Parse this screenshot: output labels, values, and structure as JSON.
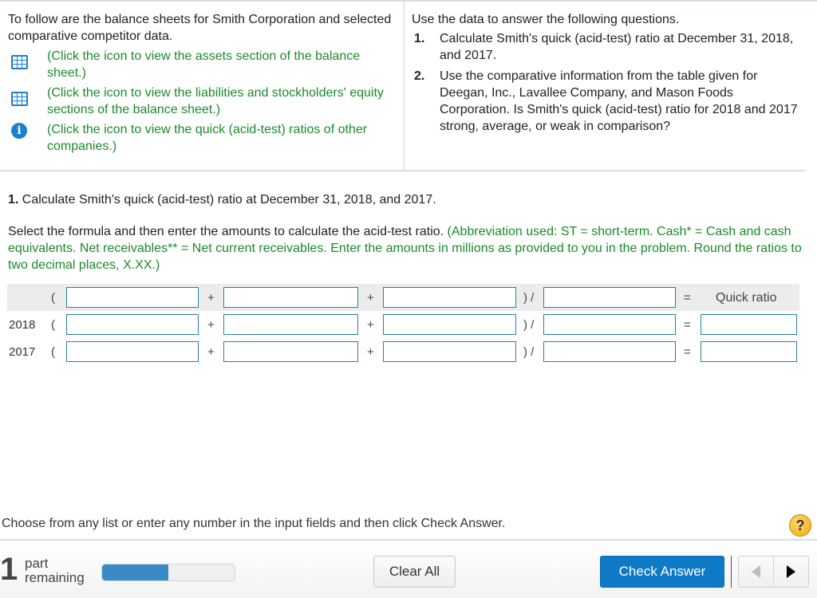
{
  "intro": {
    "text": "To follow are the balance sheets for Smith Corporation and selected comparative competitor data.",
    "links": [
      {
        "icon": "table-grid-icon",
        "text": "(Click the icon to view the assets section of the balance sheet.)"
      },
      {
        "icon": "table-grid-icon",
        "text": "(Click the icon to view the liabilities and stockholders' equity sections of the balance sheet.)"
      },
      {
        "icon": "info-icon",
        "icon_glyph": "i",
        "text": "(Click the icon to view the quick (acid-test) ratios of other companies.)"
      }
    ]
  },
  "questions": {
    "intro": "Use the data to answer the following questions.",
    "items": [
      {
        "num": "1.",
        "text": "Calculate Smith's quick (acid-test) ratio at December 31, 2018, and 2017."
      },
      {
        "num": "2.",
        "text": "Use the comparative information from the table given for Deegan, Inc., Lavallee Company, and Mason Foods Corporation. Is Smith's quick (acid-test) ratio for 2018 and 2017 strong, average, or weak in comparison?"
      }
    ]
  },
  "part1": {
    "heading_num": "1.",
    "heading_text": " Calculate Smith's quick (acid-test) ratio at December 31, 2018, and 2017.",
    "instruction_black": "Select the formula and then enter the amounts to calculate the acid-test ratio. ",
    "instruction_green": "(Abbreviation used: ST = short-term. Cash* = Cash and cash equivalents. Net receivables** = Net current receivables. Enter the amounts in millions as provided to you in the problem. Round the ratios to two decimal places, X.XX.)"
  },
  "formula": {
    "open_paren": "(",
    "plus": "+",
    "close_div": ") /",
    "equals": "=",
    "result_header": "Quick ratio",
    "rows": [
      {
        "label": "",
        "inputs": [
          "",
          "",
          "",
          ""
        ]
      },
      {
        "label": "2018",
        "inputs": [
          "",
          "",
          "",
          "",
          ""
        ]
      },
      {
        "label": "2017",
        "inputs": [
          "",
          "",
          "",
          "",
          ""
        ]
      }
    ]
  },
  "footer": {
    "message": "Choose from any list or enter any number in the input fields and then click Check Answer.",
    "help_glyph": "?",
    "parts_remaining_count": "1",
    "parts_remaining_label": "part remaining",
    "progress_fraction": 0.5,
    "clear_all": "Clear All",
    "check_answer": "Check Answer"
  },
  "colors": {
    "accent_green": "#1b8a2a",
    "icon_blue": "#1b7fd1",
    "button_blue": "#0f7ac6",
    "progress_blue": "#3a8ac6",
    "input_border": "#2a7ea0"
  }
}
